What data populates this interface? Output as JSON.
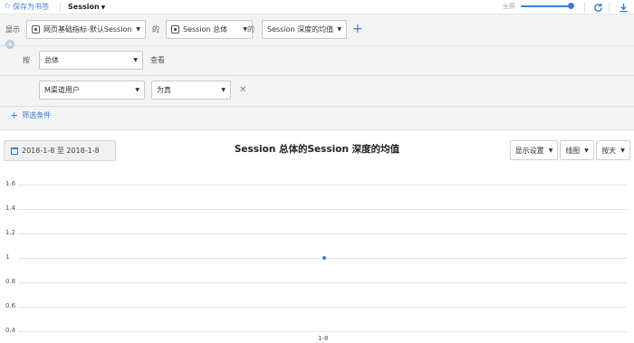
{
  "topbar": {
    "bookmark_label": "保存为书签",
    "report_name": "Session",
    "fullscreen_label": "全屏",
    "zoom_level": 0.95
  },
  "filters": {
    "show_label": "显示",
    "metric_select": "网页基础指标-默认Session",
    "of_label_1": "的",
    "entity_select": "Session 总体",
    "of_label_2": "的",
    "measure_select": "Session 深度的均值",
    "by_label": "按",
    "group_select": "总体",
    "view_label": "查看",
    "cond_field": "M渠道用户",
    "cond_op": "为真",
    "add_filter_label": "筛选条件"
  },
  "toolbar": {
    "date_range": "2018-1-8 至 2018-1-8",
    "chart_title": "Session 总体的Session 深度的均值",
    "display_settings": "显示设置",
    "chart_type": "线图",
    "granularity": "按天"
  },
  "colors": {
    "accent": "#3a7bd5",
    "panel_bg": "#f4f4f4",
    "grid": "#e4e4e4"
  },
  "chart_data": {
    "type": "line",
    "x": [
      "1-8"
    ],
    "series": [
      {
        "values": [
          1
        ]
      }
    ],
    "yticks": [
      "1.6",
      "1.4",
      "1.2",
      "1",
      "0.8",
      "0.6",
      "0.4"
    ],
    "ylim": [
      0.4,
      1.6
    ],
    "grid": true
  }
}
